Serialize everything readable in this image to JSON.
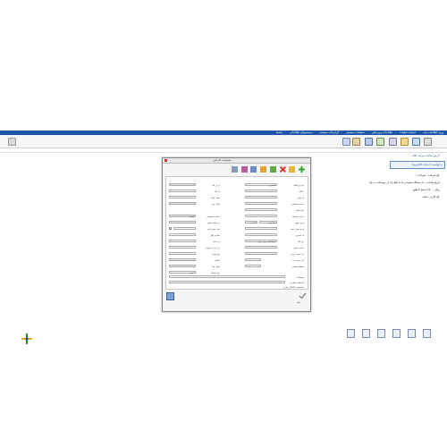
{
  "menu": [
    "ورود اطلاعات پایه",
    "عملیات شعبات",
    "اطلاعات و ویرایش",
    "تنظیمات سیستم",
    "گزارشات سیستم",
    "سیستمهای اطلاعاتی",
    "راهنما"
  ],
  "header": {
    "link1": "آدرس سامانه فرایند نگاه",
    "link2": "درخواست خدمات الکترونیک"
  },
  "info": [
    {
      "label": "نام شرکت",
      "value": "شرکت ۱"
    },
    {
      "label": "تاریخ ساعت",
      "value": "با دستکاه متنوعی ما با یکپارچه از دوساعت به یک"
    },
    {
      "label": "زمان",
      "value": "۷:۵۰ صبح تا ظهر"
    },
    {
      "label": "نام کاربر",
      "value": "مجید"
    }
  ],
  "dialog": {
    "title": "مشخصات کارتکس",
    "tab_right": "کلید تنها",
    "tab_mid": "ساختار محصول ثابتی",
    "tab_left": "تعریف جزئیات محصول",
    "labels_right": [
      "نام فروشگاه",
      "دیدگاه",
      "کد پستی",
      "شماره اقتصادی",
      "سال تیکت",
      "شماره واسطه",
      "تاریخ انتهای",
      "تاریخ تحویل ابتدا",
      "کد مشتری",
      "نوع کالا",
      "شماره اتصال",
      "کد رسمی کریده",
      "کد رسیاری به ۱",
      "منطقه تحصیلی"
    ],
    "labels_left": [
      "ارزش فلا",
      "کد کالا",
      "تحلیل کوانه",
      "تعادل بودن",
      "شماره سیستمی",
      "حد مالیات فعلی",
      "دلیل متنوع ثابت",
      "شماره پیگیر",
      "نام حامل",
      "نرخ ارزش افزوده",
      "نوع اسناد",
      "مالیات",
      "اعتبار نقد",
      "نوع اسکیما"
    ],
    "field_values": [
      "اختیاری",
      "۰۰۰",
      "۰۰۰",
      "اصلی",
      "۱۳۹۹",
      "مثلاً سیم",
      "۰۰۰",
      "۰۰۰",
      "۰۰۰",
      "جمع کالای پیش فرض",
      "اصلی",
      "رنگ"
    ],
    "bottom_labels": [
      "توضیحات",
      "ملاحظات (آنلاین)",
      "مشخصات (آمادگی قبلی)"
    ],
    "ok_label": "تائید",
    "help_label": "راهنما"
  },
  "colors": {
    "menu": "#1d56a6",
    "accent": "#2e8a2e"
  }
}
